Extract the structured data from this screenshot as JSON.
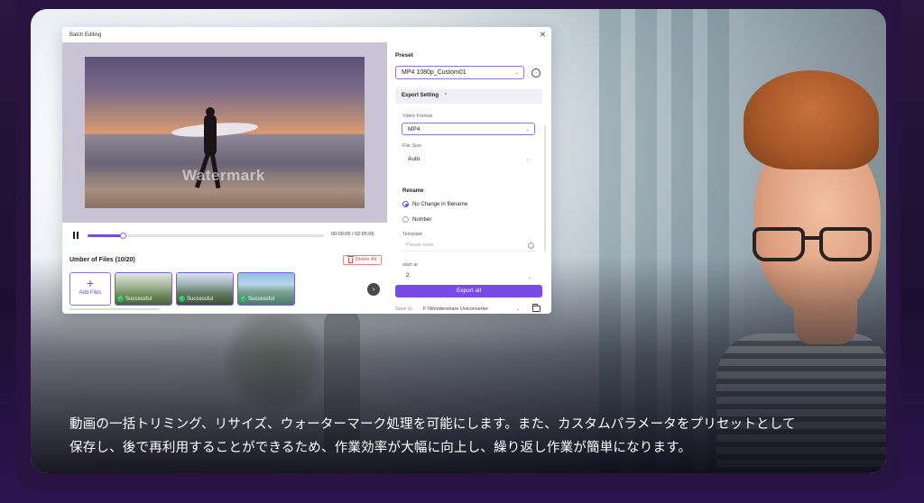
{
  "window": {
    "title": "Batch Editing",
    "close_glyph": "×"
  },
  "player": {
    "watermark_text": "Watermark",
    "time": "00:00:05 / 02:05:06",
    "progress": 0.15
  },
  "files": {
    "header": "Umber of Files (10/20)",
    "delete_label": "Delete All",
    "add_label": "Add Files",
    "add_glyph": "+",
    "items": [
      {
        "status": "Successful"
      },
      {
        "status": "Successful"
      },
      {
        "status": "Successful"
      }
    ],
    "next_glyph": "›"
  },
  "panel": {
    "preset_label": "Preset",
    "preset_value": "MP4 1080p_Custom01",
    "more_glyph": "⋯",
    "export_setting_label": "Export Setting",
    "export_setting_chev": "⌃",
    "video_format_label": "Video Format",
    "video_format_value": "MP4",
    "file_size_label": "File Size",
    "file_size_value": "Auto",
    "rename_label": "Rename",
    "rename_option_1": "No Change in filename",
    "rename_option_2": "Number",
    "template_label": "Template",
    "template_placeholder": "Please enter",
    "info_glyph": "i",
    "start_at_label": "start at",
    "start_at_value": "2",
    "export_all_label": "Export all",
    "save_to_label": "Save to",
    "save_to_path": "F:\\Wondershare Uniconverter",
    "dropdown_glyph": "⌄"
  },
  "caption": {
    "line1": "動画の一括トリミング、リサイズ、ウォーターマーク処理を可能にします。また、カスタムパラメータをプリセットとして",
    "line2": "保存し、後で再利用することができるため、作業効率が大幅に向上し、繰り返し作業が簡単になります。"
  },
  "colors": {
    "accent": "#7a4ae6",
    "success": "#2fb86a",
    "danger": "#d04a44",
    "backdrop": "#26133f"
  }
}
